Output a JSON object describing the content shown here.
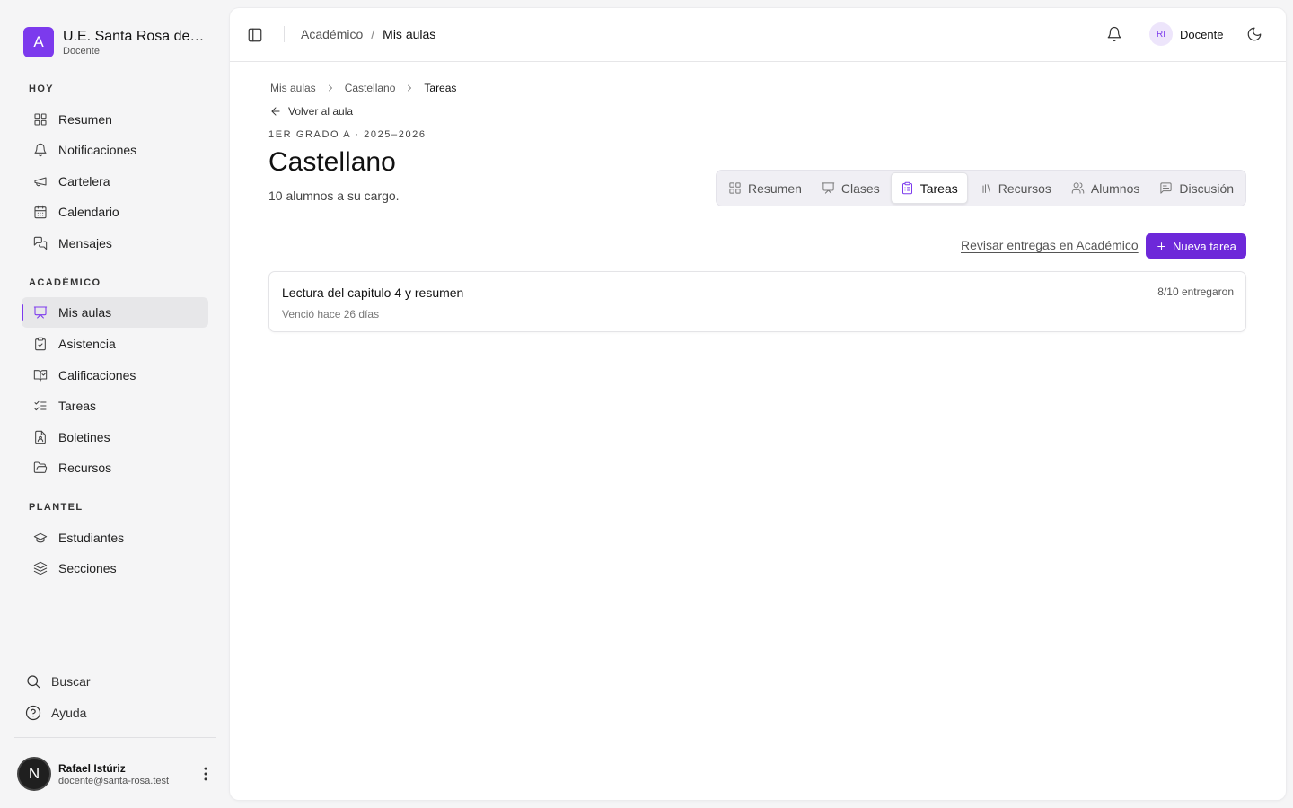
{
  "sidebar": {
    "brand": {
      "logo_letter": "A",
      "name": "U.E. Santa Rosa de Li...",
      "role": "Docente"
    },
    "groups": [
      {
        "label": "HOY",
        "items": [
          {
            "label": "Resumen",
            "icon": "grid-icon"
          },
          {
            "label": "Notificaciones",
            "icon": "bell-icon"
          },
          {
            "label": "Cartelera",
            "icon": "megaphone-icon"
          },
          {
            "label": "Calendario",
            "icon": "calendar-icon"
          },
          {
            "label": "Mensajes",
            "icon": "messages-icon"
          }
        ]
      },
      {
        "label": "ACADÉMICO",
        "items": [
          {
            "label": "Mis aulas",
            "icon": "presentation-icon",
            "active": true
          },
          {
            "label": "Asistencia",
            "icon": "clipboard-check-icon"
          },
          {
            "label": "Calificaciones",
            "icon": "book-check-icon"
          },
          {
            "label": "Tareas",
            "icon": "list-checks-icon"
          },
          {
            "label": "Boletines",
            "icon": "file-user-icon"
          },
          {
            "label": "Recursos",
            "icon": "folder-open-icon"
          }
        ]
      },
      {
        "label": "PLANTEL",
        "items": [
          {
            "label": "Estudiantes",
            "icon": "graduation-cap-icon"
          },
          {
            "label": "Secciones",
            "icon": "layers-icon"
          }
        ]
      }
    ],
    "bottom": [
      {
        "label": "Buscar",
        "icon": "search-icon"
      },
      {
        "label": "Ayuda",
        "icon": "help-circle-icon"
      }
    ],
    "user": {
      "avatar_letter": "N",
      "name": "Rafael Istúriz",
      "email": "docente@santa-rosa.test"
    }
  },
  "topbar": {
    "breadcrumb": [
      "Académico",
      "/",
      "Mis aulas"
    ],
    "account": {
      "initials": "RI",
      "name": "Docente"
    }
  },
  "page": {
    "breadcrumb": [
      "Mis aulas",
      "Castellano",
      "Tareas"
    ],
    "back_label": "Volver al aula",
    "eyebrow": "1ER GRADO A · 2025–2026",
    "title": "Castellano",
    "subtitle": "10 alumnos a su cargo.",
    "tabs": [
      {
        "label": "Resumen",
        "icon": "grid-icon"
      },
      {
        "label": "Clases",
        "icon": "presentation-icon"
      },
      {
        "label": "Tareas",
        "icon": "clipboard-icon",
        "active": true
      },
      {
        "label": "Recursos",
        "icon": "library-icon"
      },
      {
        "label": "Alumnos",
        "icon": "users-icon"
      },
      {
        "label": "Discusión",
        "icon": "message-square-text-icon"
      }
    ],
    "review_link": "Revisar entregas en Académico",
    "new_task_label": "Nueva tarea",
    "tasks": [
      {
        "title": "Lectura del capitulo 4 y resumen",
        "due": "Venció hace 26 días",
        "count": "8/10 entregaron"
      }
    ]
  },
  "colors": {
    "accent": "#7c3aed",
    "button": "#6d28d9"
  }
}
